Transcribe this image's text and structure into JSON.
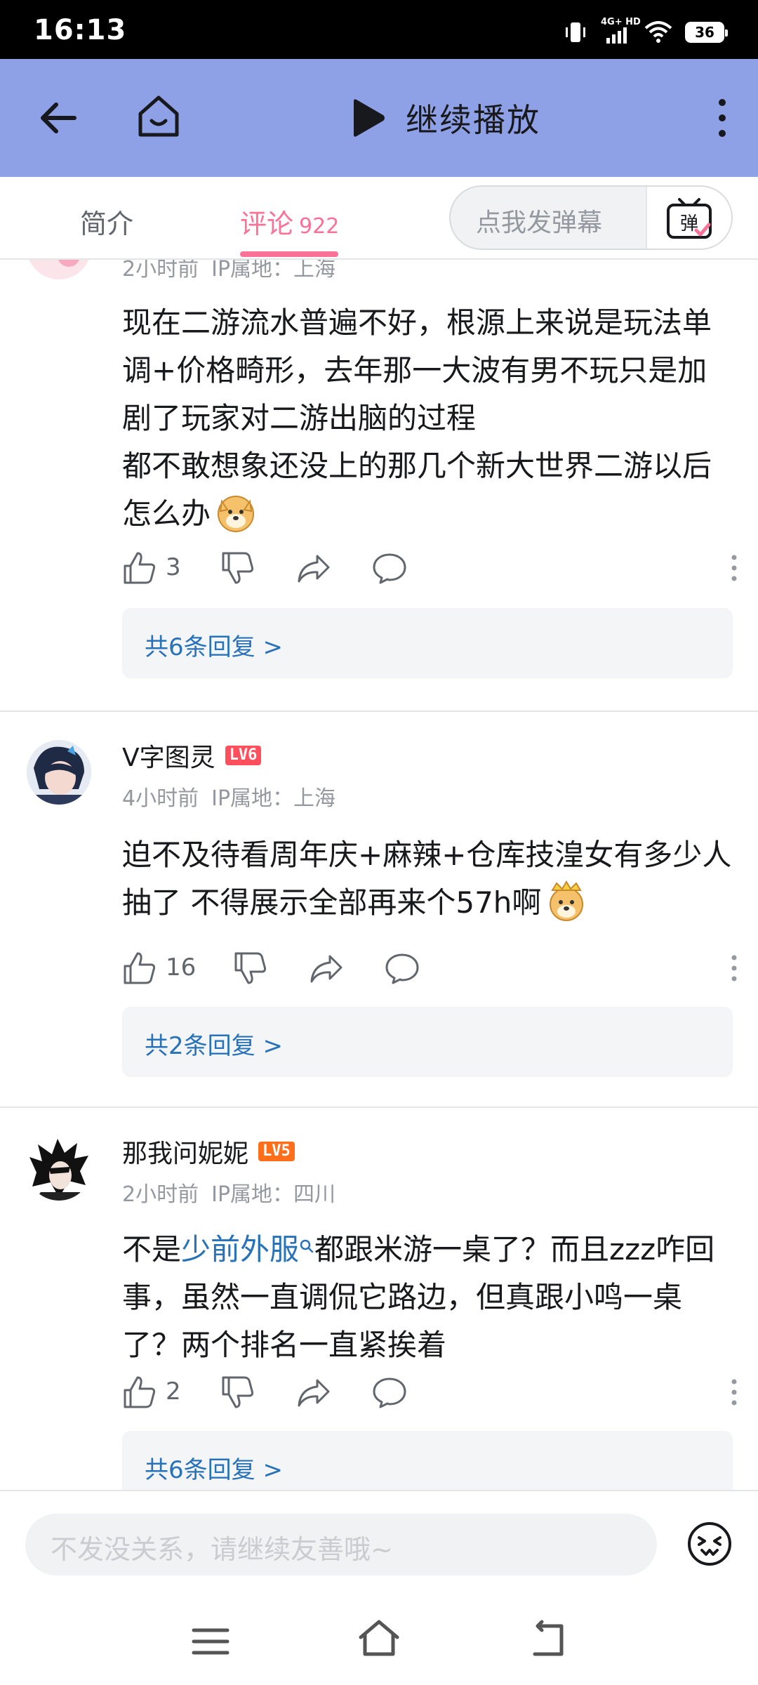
{
  "status_bar": {
    "time": "16:13",
    "network": "4G+ HD",
    "battery": "36"
  },
  "header": {
    "play_label": "继续播放"
  },
  "tabs": {
    "intro": "简介",
    "comments": "评论",
    "comments_count": "922",
    "danmaku_placeholder": "点我发弹幕",
    "danmaku_button": "弹"
  },
  "comments": [
    {
      "meta_time": "2小时前",
      "meta_ip": "IP属地：上海",
      "text": "现在二游流水普遍不好，根源上来说是玩法单调+价格畸形，去年那一大波有男不玩只是加剧了玩家对二游出脑的过程\n都不敢想象还没上的那几个新大世界二游以后怎么办",
      "emoji": "doge-emoji",
      "likes": "3",
      "replies": "共6条回复 >"
    },
    {
      "name": "V字图灵",
      "level": "LV6",
      "meta_time": "4小时前",
      "meta_ip": "IP属地：上海",
      "text": "迫不及待看周年庆+麻辣+仓库技湟女有多少人抽了 不得展示全部再来个57h啊",
      "emoji": "doge-crown-emoji",
      "likes": "16",
      "replies": "共2条回复 >"
    },
    {
      "name": "那我问妮妮",
      "level": "LV5",
      "meta_time": "2小时前",
      "meta_ip": "IP属地：四川",
      "text_before": "不是",
      "link": "少前外服",
      "text_after": "都跟米游一桌了？而且zzz咋回事，虽然一直调侃它路边，但真跟小鸣一桌了？两个排名一直紧挨着",
      "likes": "2",
      "replies": "共6条回复 >"
    }
  ],
  "input_bar": {
    "placeholder": "不发没关系，请继续友善哦~"
  },
  "colors": {
    "header_bg": "#8fa1e6",
    "accent": "#fb7299",
    "link": "#2772b9"
  }
}
